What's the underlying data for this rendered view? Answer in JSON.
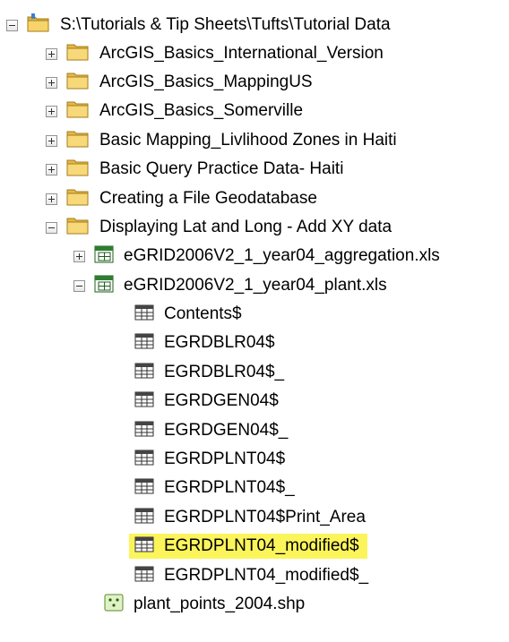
{
  "tree": {
    "root": {
      "label": "S:\\Tutorials & Tip Sheets\\Tufts\\Tutorial Data"
    },
    "folders": [
      {
        "label": "ArcGIS_Basics_International_Version"
      },
      {
        "label": "ArcGIS_Basics_MappingUS"
      },
      {
        "label": "ArcGIS_Basics_Somerville"
      },
      {
        "label": "Basic Mapping_Livlihood Zones in Haiti"
      },
      {
        "label": "Basic Query Practice Data- Haiti"
      },
      {
        "label": "Creating a File Geodatabase"
      },
      {
        "label": "Displaying Lat and Long - Add XY data"
      }
    ],
    "workbooks": [
      {
        "label": "eGRID2006V2_1_year04_aggregation.xls"
      },
      {
        "label": "eGRID2006V2_1_year04_plant.xls"
      }
    ],
    "sheets": [
      {
        "label": "Contents$"
      },
      {
        "label": "EGRDBLR04$"
      },
      {
        "label": "EGRDBLR04$_"
      },
      {
        "label": "EGRDGEN04$"
      },
      {
        "label": "EGRDGEN04$_"
      },
      {
        "label": "EGRDPLNT04$"
      },
      {
        "label": "EGRDPLNT04$_"
      },
      {
        "label": "EGRDPLNT04$Print_Area"
      },
      {
        "label": "EGRDPLNT04_modified$",
        "highlighted": true
      },
      {
        "label": "EGRDPLNT04_modified$_"
      }
    ],
    "shapefile": {
      "label": "plant_points_2004.shp"
    }
  },
  "colors": {
    "highlight": "#fbf55b",
    "folder": "#f2c94c",
    "table_icon": "#1b5e20"
  },
  "icons": {
    "expand": "expand-plus-icon",
    "collapse": "collapse-minus-icon",
    "folder": "folder-icon",
    "workbook": "excel-workbook-icon",
    "table": "table-icon",
    "shapefile": "point-shapefile-icon"
  }
}
